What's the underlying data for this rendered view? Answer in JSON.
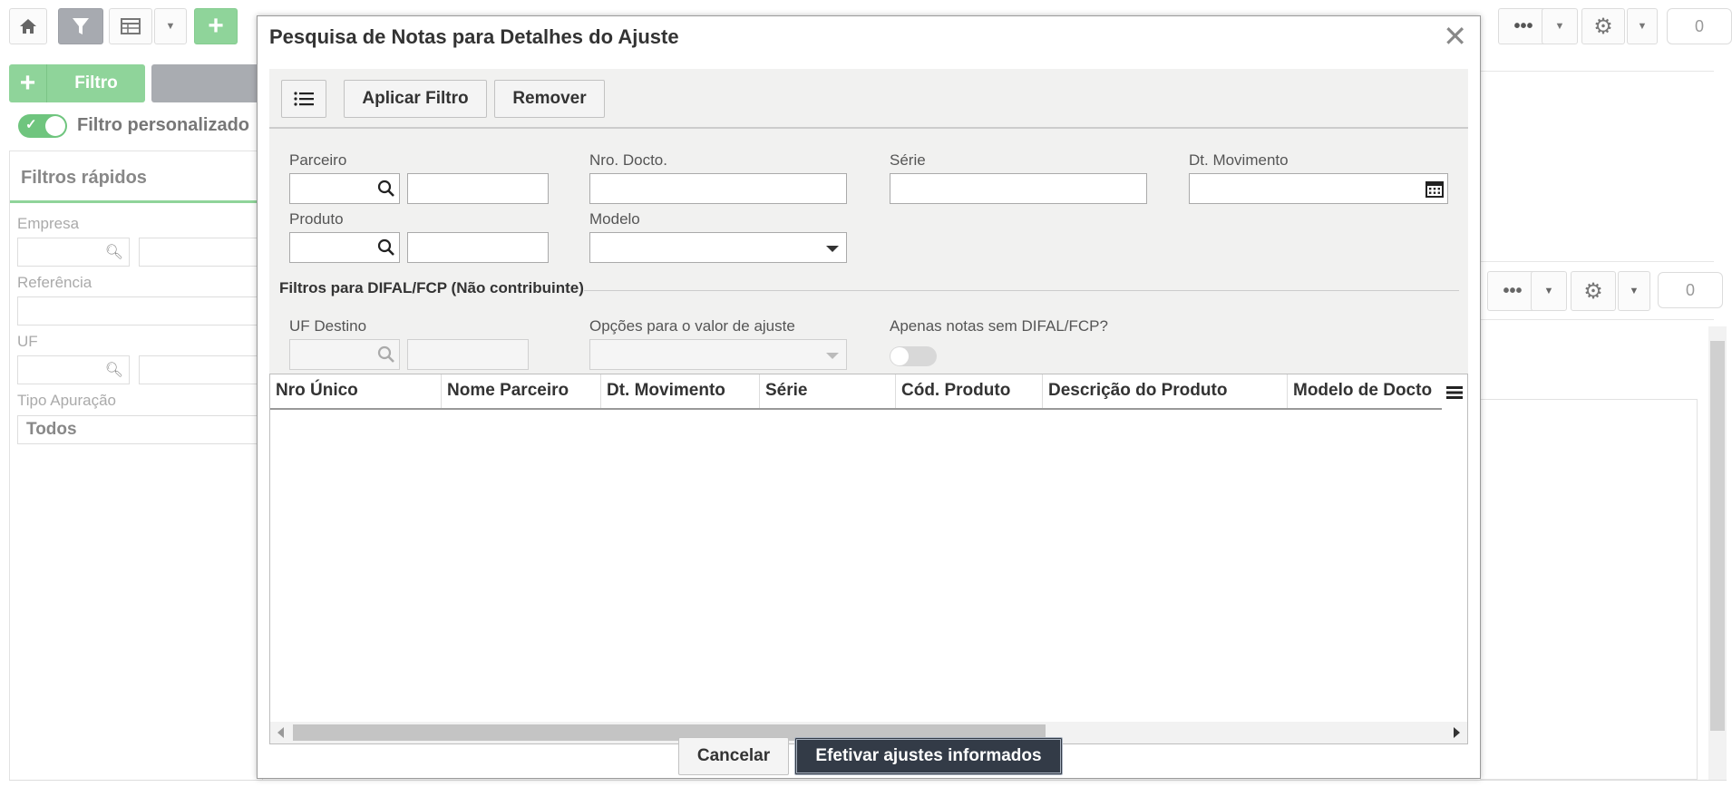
{
  "background": {
    "toolbar": {
      "counter_value": "0"
    },
    "add_filter_label": "Filtro",
    "custom_filter_label": "Filtro personalizado",
    "quick_filters": {
      "title": "Filtros rápidos",
      "empresa_label": "Empresa",
      "referencia_label": "Referência",
      "uf_label": "UF",
      "tipo_apuracao_label": "Tipo Apuração",
      "tipo_apuracao_value": "Todos"
    },
    "right_counter_value": "0"
  },
  "modal": {
    "title": "Pesquisa de Notas para Detalhes do Ajuste",
    "toolbar": {
      "apply_label": "Aplicar Filtro",
      "remove_label": "Remover"
    },
    "fields": {
      "parceiro_label": "Parceiro",
      "nro_docto_label": "Nro. Docto.",
      "serie_label": "Série",
      "dt_movimento_label": "Dt. Movimento",
      "produto_label": "Produto",
      "modelo_label": "Modelo"
    },
    "difal_section": {
      "title": "Filtros para DIFAL/FCP (Não contribuinte)",
      "uf_destino_label": "UF Destino",
      "opcoes_label": "Opções para o valor de ajuste",
      "apenas_label": "Apenas notas sem DIFAL/FCP?"
    },
    "grid": {
      "columns": [
        "Nro Único",
        "Nome Parceiro",
        "Dt. Movimento",
        "Série",
        "Cód. Produto",
        "Descrição do Produto",
        "Modelo de Docto"
      ],
      "rows": []
    },
    "footer": {
      "cancel_label": "Cancelar",
      "confirm_label": "Efetivar ajustes informados"
    }
  }
}
